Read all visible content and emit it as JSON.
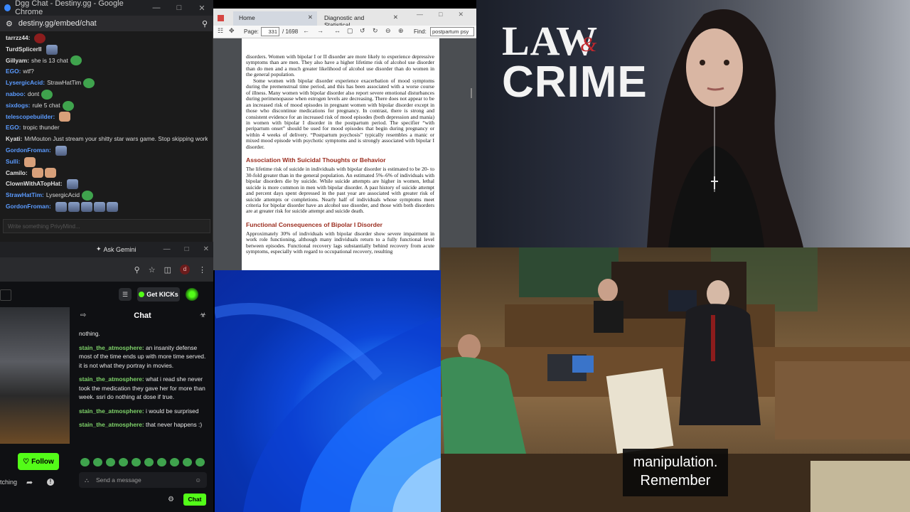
{
  "dgg": {
    "tab_title": "Dgg Chat - Destiny.gg - Google Chrome",
    "url": "destiny.gg/embed/chat",
    "input_placeholder": "Write something PrivyMind...",
    "messages": [
      {
        "nick": "tarrzz44:",
        "color": "#e0e0e0",
        "text": "",
        "emotes": [
          "red"
        ]
      },
      {
        "nick": "TurdSplicerII",
        "color": "#e0e0e0",
        "text": "",
        "emotes": [
          "face"
        ]
      },
      {
        "nick": "Gillyam:",
        "color": "#e0e0e0",
        "text": "she is 13 chat",
        "emotes": [
          "pepe"
        ]
      },
      {
        "nick": "EGO:",
        "color": "#5b9bff",
        "text": "wtf?",
        "emotes": []
      },
      {
        "nick": "LysergicAcid:",
        "color": "#5b9bff",
        "text": "StrawHatTim",
        "emotes": [
          "pepe"
        ]
      },
      {
        "nick": "naboo:",
        "color": "#5b9bff",
        "text": "dont",
        "emotes": [
          "pepe"
        ]
      },
      {
        "nick": "sixdogs:",
        "color": "#5b9bff",
        "text": "rule 5 chat",
        "emotes": [
          "pepe"
        ]
      },
      {
        "nick": "telescopebuilder:",
        "color": "#5b9bff",
        "text": "",
        "emotes": [
          "hand"
        ]
      },
      {
        "nick": "EGO:",
        "color": "#5b9bff",
        "text": "tropic thunder",
        "emotes": []
      },
      {
        "nick": "Kyati:",
        "color": "#e0e0e0",
        "text": "MrMouton Just stream your shitty star wars game. Stop skipping work",
        "emotes": [
          "face"
        ]
      },
      {
        "nick": "GordonFroman:",
        "color": "#5b9bff",
        "text": "",
        "emotes": [
          "face"
        ]
      },
      {
        "nick": "Sulli:",
        "color": "#5b9bff",
        "text": "",
        "emotes": [
          "hand"
        ]
      },
      {
        "nick": "Camilo:",
        "color": "#e0e0e0",
        "text": "",
        "emotes": [
          "hand",
          "hand"
        ]
      },
      {
        "nick": "ClownWithATopHat:",
        "color": "#e0e0e0",
        "text": "",
        "emotes": [
          "face"
        ]
      },
      {
        "nick": "StrawHatTim:",
        "color": "#5b9bff",
        "text": "LysergicAcid",
        "emotes": [
          "pepe"
        ]
      },
      {
        "nick": "GordonFroman:",
        "color": "#5b9bff",
        "text": "",
        "emotes": [
          "face",
          "face",
          "face",
          "face",
          "face"
        ]
      }
    ]
  },
  "kick": {
    "ask_gemini": "Ask Gemini",
    "get_kicks": "Get KICKs",
    "chat_title": "Chat",
    "follow": "Follow",
    "watching": "tching",
    "send_placeholder": "Send a message",
    "chat_button": "Chat",
    "messages": [
      {
        "nick": "",
        "text": "nothing."
      },
      {
        "nick": "stain_the_atmosphere:",
        "text": "an insanity defense most of the time ends up with more time served. it is not what they portray in movies."
      },
      {
        "nick": "stain_the_atmosphere:",
        "text": "what i read she never took the medication they gave her for more than week. ssri do nothing at dose if true."
      },
      {
        "nick": "stain_the_atmosphere:",
        "text": "i would be surprised"
      },
      {
        "nick": "stain_the_atmosphere:",
        "text": "that never happens :)"
      }
    ]
  },
  "pdf": {
    "tab_home": "Home",
    "tab_doc": "Diagnostic and Statistical...",
    "page_label": "Page:",
    "page_current": "331",
    "page_total": "/ 1698",
    "find_label": "Find:",
    "find_value": "postpartum psy",
    "para1": "disorders. Women with bipolar I or II disorder are more likely to experience depressive symptoms than are men. They also have a higher lifetime risk of alcohol use disorder than do men and a much greater likelihood of alcohol use disorder than do women in the general population.",
    "para2": "Some women with bipolar disorder experience exacerbation of mood symptoms during the premenstrual time period, and this has been associated with a worse course of illness. Many women with bipolar disorder also report severe emotional disturbances during perimenopause when estrogen levels are decreasing. There does not appear to be an increased risk of mood episodes in pregnant women with bipolar disorder except in those who discontinue medications for pregnancy. In contrast, there is strong and consistent evidence for an increased risk of mood episodes (both depression and mania) in women with bipolar I disorder in the postpartum period. The specifier “with peripartum onset” should be used for mood episodes that begin during pregnancy or within 4 weeks of delivery. “Postpartum psychosis” typically resembles a manic or mixed mood episode with psychotic symptoms and is strongly associated with bipolar I disorder.",
    "heading1": "Association With Suicidal Thoughts or Behavior",
    "para3": "The lifetime risk of suicide in individuals with bipolar disorder is estimated to be 20- to 30-fold greater than in the general population. An estimated 5%–6% of individuals with bipolar disorders die by suicide. While suicide attempts are higher in women, lethal suicide is more common in men with bipolar disorder. A past history of suicide attempt and percent days spent depressed in the past year are associated with greater risk of suicide attempts or completions. Nearly half of individuals whose symptoms meet criteria for bipolar disorder have an alcohol use disorder, and those with both disorders are at greater risk for suicide attempt and suicide death.",
    "heading2": "Functional Consequences of Bipolar I Disorder",
    "para4": "Approximately 30% of individuals with bipolar disorder show severe impairment in work role functioning, although many individuals return to a fully functional level between episodes. Functional recovery lags substantially behind recovery from acute symptoms, especially with regard to occupational recovery, resulting"
  },
  "lawcrime": {
    "logo_law": "LAW",
    "logo_amp": "&",
    "logo_crime": "CRIME"
  },
  "court": {
    "caption_line1": "manipulation.",
    "caption_line2": "Remember"
  }
}
